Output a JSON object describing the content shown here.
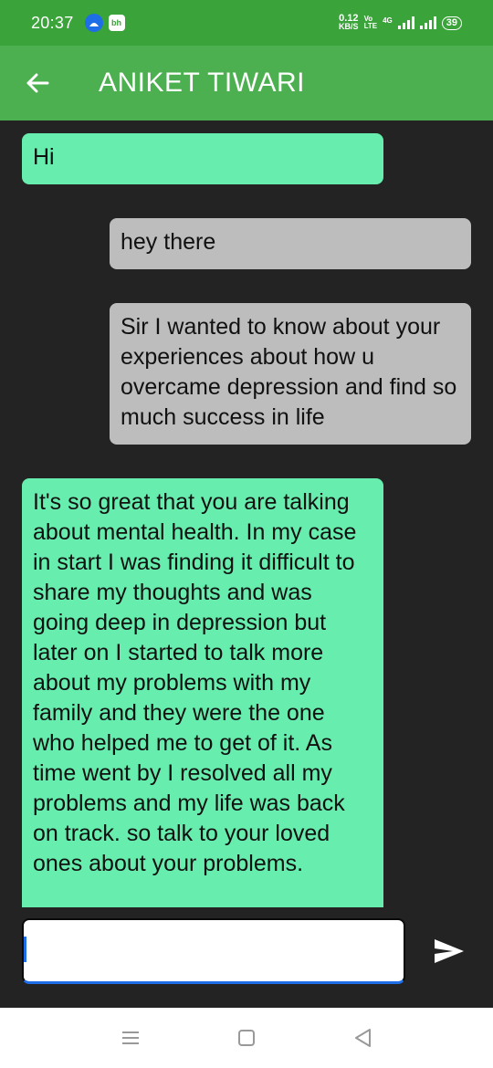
{
  "status": {
    "time": "20:37",
    "app_icon_b": "bh",
    "net_speed_value": "0.12",
    "net_speed_unit": "KB/S",
    "volte_top": "Vo",
    "volte_bottom": "LTE",
    "network_type": "4G",
    "battery": "39"
  },
  "header": {
    "title": "ANIKET TIWARI",
    "back_icon": "arrow-left-icon"
  },
  "messages": [
    {
      "sender": "them",
      "text": "Hi"
    },
    {
      "sender": "me",
      "text": "hey there"
    },
    {
      "sender": "me",
      "text": "Sir I wanted to know about your experiences about how u overcame depression and find so much success in life"
    },
    {
      "sender": "them",
      "text": "It's so great that you are talking about mental health. In my case in start I was finding it difficult to share my thoughts and was going deep in depression but later on I started to talk more about my problems with my family and they were the one who helped me to get of it. As time went by I resolved all my problems and my life was back on track. so talk to your loved ones about your problems."
    }
  ],
  "composer": {
    "value": "",
    "placeholder": "",
    "send_icon": "send-icon"
  },
  "nav": {
    "recents_icon": "recents-icon",
    "home_icon": "home-icon",
    "back_icon": "nav-back-icon"
  },
  "colors": {
    "status_bar": "#3aa33a",
    "app_bar": "#4caf50",
    "incoming_bubble": "#67edad",
    "outgoing_bubble": "#bdbdbd",
    "background": "#232323",
    "accent": "#1e6ee8"
  }
}
